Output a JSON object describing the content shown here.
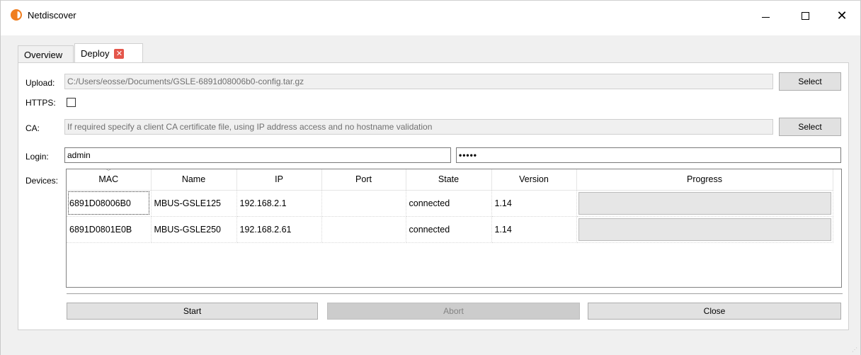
{
  "window": {
    "title": "Netdiscover",
    "minimize_icon": "minimize-icon",
    "maximize_icon": "maximize-icon",
    "close_icon": "close-icon",
    "accent_color": "#f07d1e"
  },
  "tabs": [
    {
      "label": "Overview",
      "active": false
    },
    {
      "label": "Deploy",
      "active": true,
      "close_icon": "tab-close-icon"
    }
  ],
  "form": {
    "upload_label": "Upload:",
    "upload_value": "C:/Users/eosse/Documents/GSLE-6891d08006b0-config.tar.gz",
    "select_upload_label": "Select",
    "https_label": "HTTPS:",
    "https_checked": false,
    "ca_label": "CA:",
    "ca_placeholder": "If required specify a client CA certificate file, using IP address access and no hostname validation",
    "select_ca_label": "Select",
    "login_label": "Login:",
    "login_value": "admin",
    "password_masked": "•••••",
    "devices_label": "Devices:"
  },
  "devices": {
    "columns": [
      "MAC",
      "Name",
      "IP",
      "Port",
      "State",
      "Version",
      "Progress"
    ],
    "rows": [
      {
        "mac": "6891D08006B0",
        "name": "MBUS-GSLE125",
        "ip": "192.168.2.1",
        "port": "",
        "state": "connected",
        "version": "1.14",
        "progress": 0
      },
      {
        "mac": "6891D0801E0B",
        "name": "MBUS-GSLE250",
        "ip": "192.168.2.61",
        "port": "",
        "state": "connected",
        "version": "1.14",
        "progress": 0
      }
    ]
  },
  "actions": {
    "start_label": "Start",
    "abort_label": "Abort",
    "abort_disabled": true,
    "close_label": "Close"
  }
}
